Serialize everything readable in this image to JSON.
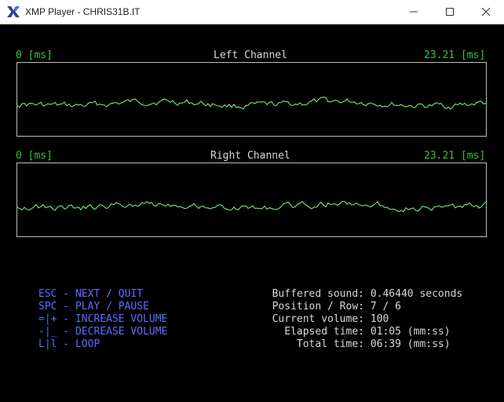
{
  "window": {
    "title": "XMP Player - CHRIS31B.IT"
  },
  "left_channel": {
    "title": "Left Channel",
    "time_start": "0 [ms]",
    "time_end": "23.21 [ms]",
    "wave_color": "#7cff7c"
  },
  "right_channel": {
    "title": "Right Channel",
    "time_start": "0 [ms]",
    "time_end": "23.21 [ms]",
    "wave_color": "#7cff7c"
  },
  "keys": [
    "ESC - NEXT / QUIT",
    "SPC - PLAY / PAUSE",
    "=|+ - INCREASE VOLUME",
    "-|_ - DECREASE VOLUME",
    "L|l - LOOP"
  ],
  "info": [
    {
      "label": "Buffered sound:",
      "value": "0.46440 seconds"
    },
    {
      "label": "Position / Row:",
      "value": "7 / 6"
    },
    {
      "label": "Current volume:",
      "value": "100"
    },
    {
      "label": "Elapsed time:",
      "value": "01:05 (mm:ss)"
    },
    {
      "label": "Total time:",
      "value": "06:39 (mm:ss)"
    }
  ],
  "colors": {
    "label_green": "#35c435",
    "key_blue": "#5b6cff",
    "text_white": "#d8d8d8",
    "background": "#000000"
  },
  "icons": {
    "app": "x-logo-icon",
    "minimize": "minimize-icon",
    "maximize": "maximize-icon",
    "close": "close-icon"
  }
}
